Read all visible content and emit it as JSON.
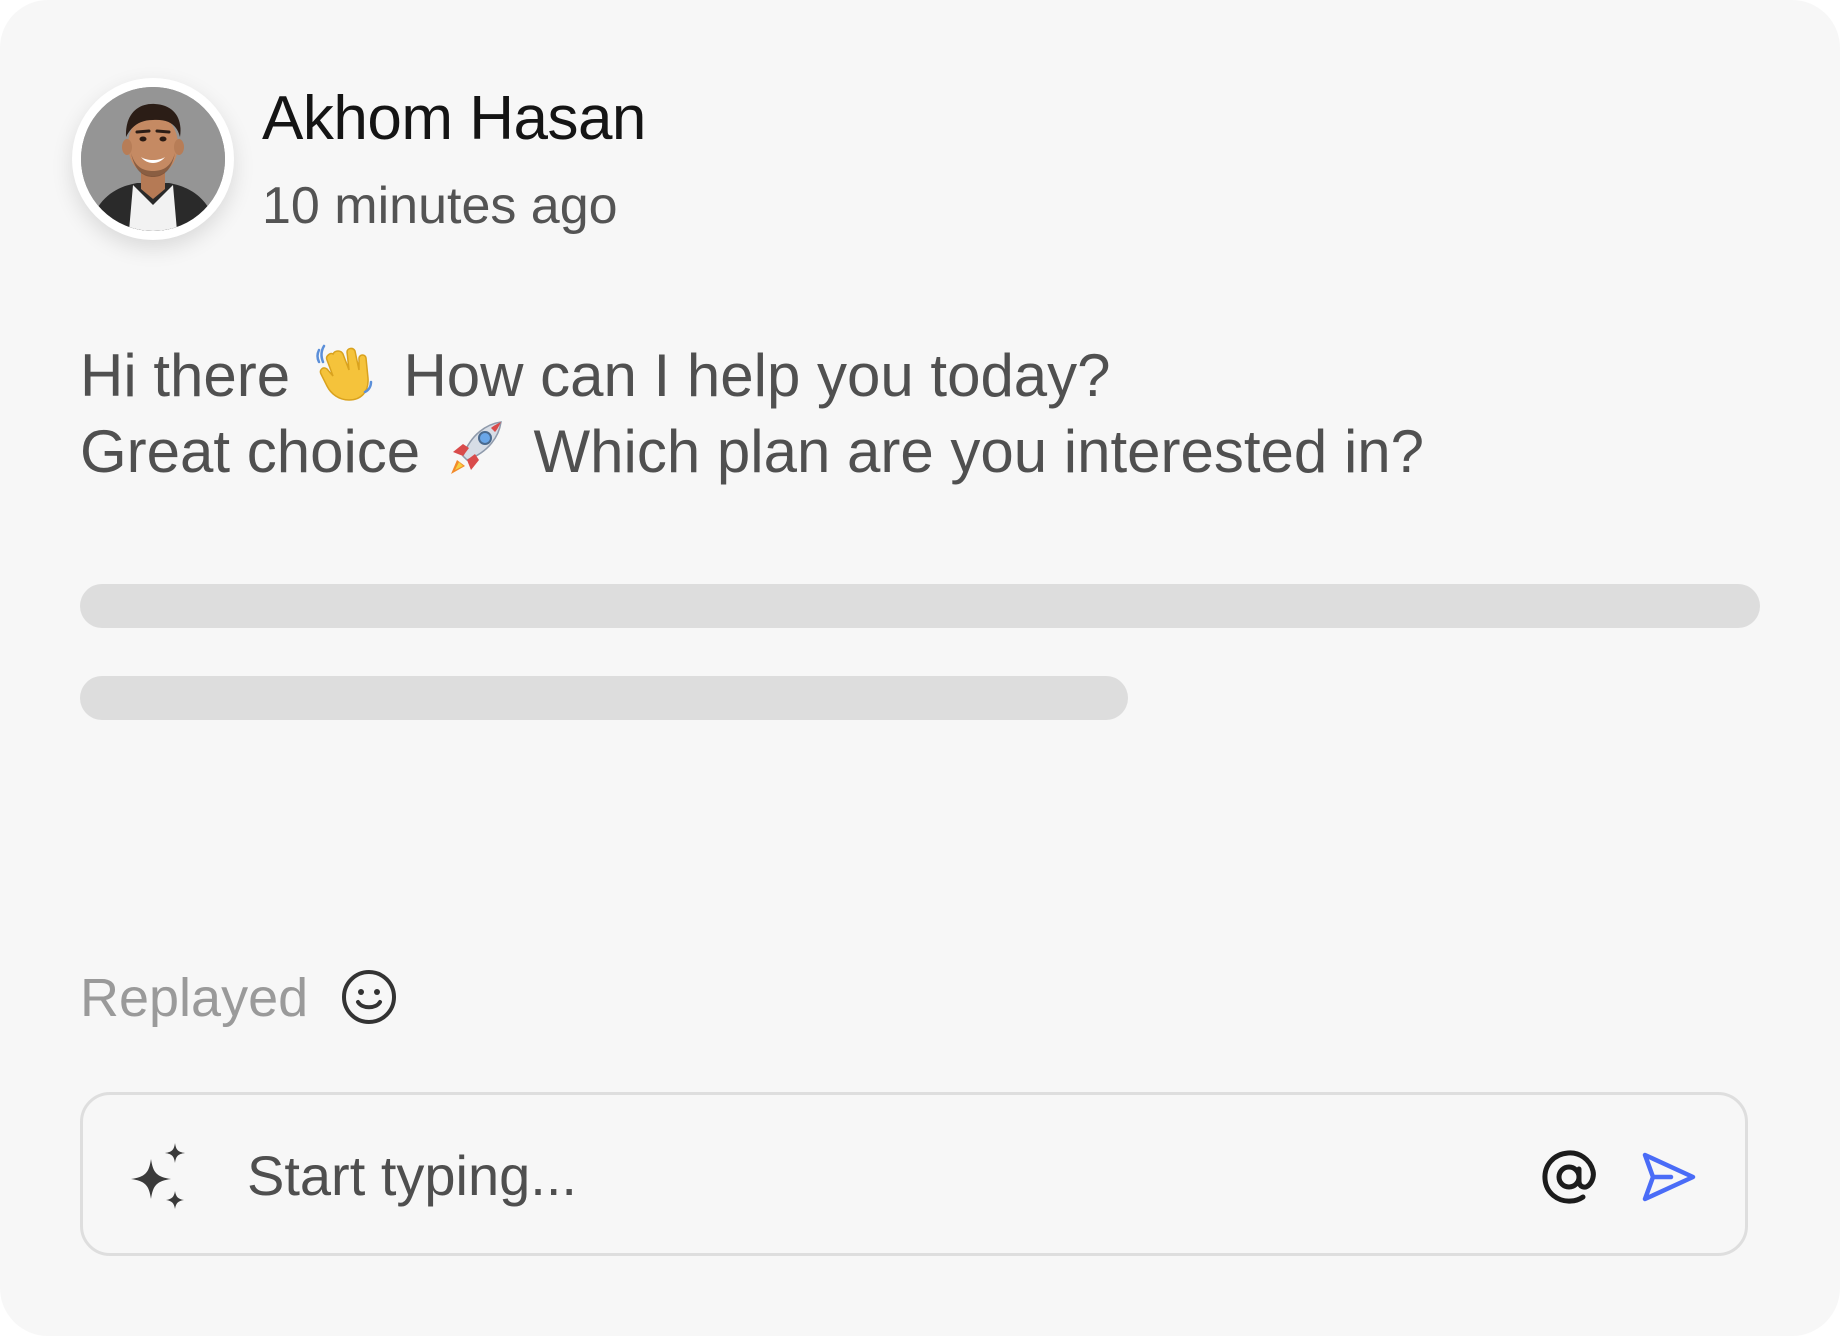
{
  "author": {
    "name": "Akhom Hasan",
    "timestamp": "10 minutes ago"
  },
  "message": {
    "line1_a": "Hi there",
    "line1_emoji": "waving-hand-emoji",
    "line1_b": "How can I help you today?",
    "line2_a": "Great choice",
    "line2_emoji": "rocket-emoji",
    "line2_b": "Which plan are you interested in?"
  },
  "status": {
    "label": "Replayed"
  },
  "composer": {
    "placeholder": "Start typing...",
    "ai_icon": "sparkle-icon",
    "mention_icon": "at-icon",
    "send_icon": "send-icon"
  },
  "colors": {
    "background": "#f7f7f7",
    "skeleton": "#dddddd",
    "send_accent": "#4a6cf7",
    "text_primary": "#141414",
    "text_muted": "#9a9a9a"
  }
}
